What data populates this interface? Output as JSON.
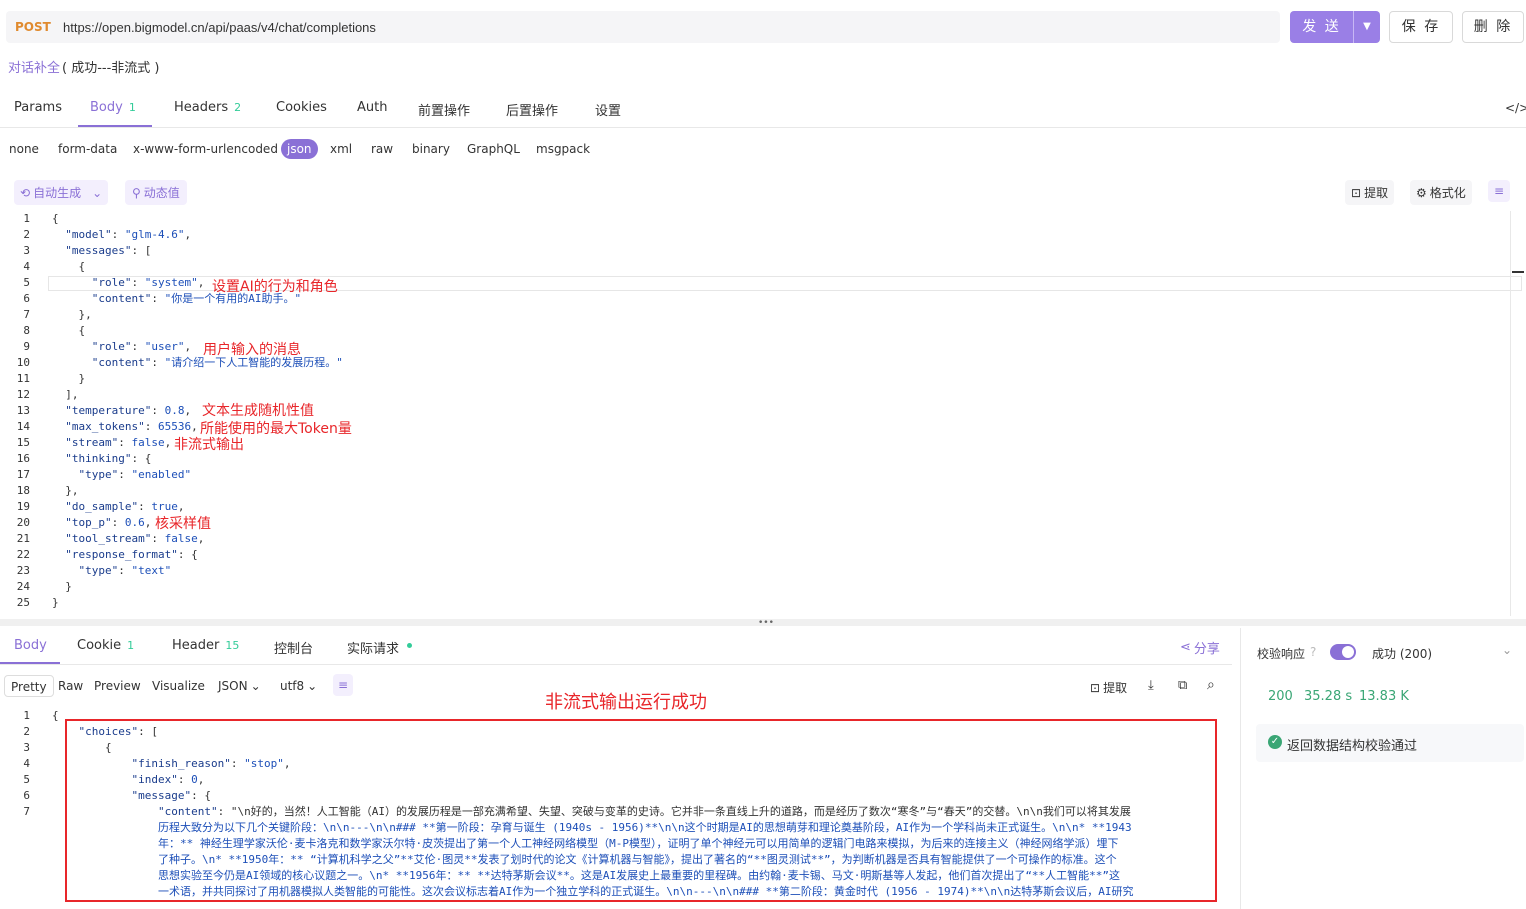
{
  "request": {
    "method": "POST",
    "url": "https://open.bigmodel.cn/api/paas/v4/chat/completions",
    "send_label": "发 送",
    "save_label": "保 存",
    "delete_label": "删 除",
    "name": "对话补全",
    "name_suffix": "( 成功---非流式 )"
  },
  "req_tabs": [
    {
      "label": "Params",
      "count": ""
    },
    {
      "label": "Body",
      "count": "1"
    },
    {
      "label": "Headers",
      "count": "2"
    },
    {
      "label": "Cookies",
      "count": ""
    },
    {
      "label": "Auth",
      "count": ""
    },
    {
      "label": "前置操作",
      "count": ""
    },
    {
      "label": "后置操作",
      "count": ""
    },
    {
      "label": "设置",
      "count": ""
    }
  ],
  "body_types": [
    "none",
    "form-data",
    "x-www-form-urlencoded",
    "json",
    "xml",
    "raw",
    "binary",
    "GraphQL",
    "msgpack"
  ],
  "toolbar": {
    "auto_gen": "自动生成",
    "dynamic": "动态值",
    "extract": "提取",
    "format": "格式化"
  },
  "code_lines": [
    "{",
    "  \"model\": \"glm-4.6\",",
    "  \"messages\": [",
    "    {",
    "      \"role\": \"system\",",
    "      \"content\": \"你是一个有用的AI助手。\"",
    "    },",
    "    {",
    "      \"role\": \"user\",",
    "      \"content\": \"请介绍一下人工智能的发展历程。\"",
    "    }",
    "  ],",
    "  \"temperature\": 0.8,",
    "  \"max_tokens\": 65536,",
    "  \"stream\": false,",
    "  \"thinking\": {",
    "    \"type\": \"enabled\"",
    "  },",
    "  \"do_sample\": true,",
    "  \"top_p\": 0.6,",
    "  \"tool_stream\": false,",
    "  \"response_format\": {",
    "    \"type\": \"text\"",
    "  }",
    "}"
  ],
  "annotations": {
    "system": "设置AI的行为和角色",
    "user": "用户输入的消息",
    "temperature": "文本生成随机性值",
    "max_tokens": "所能使用的最大Token量",
    "stream": "非流式输出",
    "top_p": "核采样值",
    "result": "非流式输出运行成功"
  },
  "resp_tabs": [
    {
      "label": "Body",
      "count": ""
    },
    {
      "label": "Cookie",
      "count": "1"
    },
    {
      "label": "Header",
      "count": "15"
    },
    {
      "label": "控制台",
      "count": ""
    },
    {
      "label": "实际请求",
      "count": ""
    }
  ],
  "share_label": "分享",
  "view_modes": [
    "Pretty",
    "Raw",
    "Preview",
    "Visualize"
  ],
  "format_select": "JSON",
  "encoding_select": "utf8",
  "resp_extract": "提取",
  "resp_lines": [
    "{",
    "    \"choices\": [",
    "        {",
    "            \"finish_reason\": \"stop\",",
    "            \"index\": 0,",
    "            \"message\": {",
    "                \"content\": \"\\n好的，当然！人工智能（AI）的发展历程是一部充满希望、失望、突破与变革的史诗。它并非一条直线上升的道路，而是经历了数次“寒冬”与“春天”的交替。\\n\\n我们可以将其发展"
  ],
  "resp_wrap": [
    "历程大致分为以下几个关键阶段：\\n\\n---\\n\\n### **第一阶段：孕育与诞生 (1940s - 1956)**\\n\\n这个时期是AI的思想萌芽和理论奠基阶段，AI作为一个学科尚未正式诞生。\\n\\n*   **1943",
    "年：** 神经生理学家沃伦·麦卡洛克和数学家沃尔特·皮茨提出了第一个人工神经网络模型（M-P模型），证明了单个神经元可以用简单的逻辑门电路来模拟，为后来的连接主义（神经网络学派）埋下",
    "了种子。\\n*   **1950年：** “计算机科学之父”**艾伦·图灵**发表了划时代的论文《计算机器与智能》，提出了著名的“**图灵测试**”，为判断机器是否具有智能提供了一个可操作的标准。这个",
    "思想实验至今仍是AI领域的核心议题之一。\\n*   **1956年：** **达特茅斯会议**。这是AI发展史上最重要的里程碑。由约翰·麦卡锡、马文·明斯基等人发起，他们首次提出了“**人工智能**”这",
    "一术语，并共同探讨了用机器模拟人类智能的可能性。这次会议标志着AI作为一个独立学科的正式诞生。\\n\\n---\\n\\n### **第二阶段：黄金时代 (1956 - 1974)**\\n\\n达特茅斯会议后，AI研究"
  ],
  "validation": {
    "label": "校验响应",
    "status": "成功 (200)",
    "code": "200",
    "time": "35.28 s",
    "size": "13.83 K",
    "result": "返回数据结构校验通过"
  }
}
